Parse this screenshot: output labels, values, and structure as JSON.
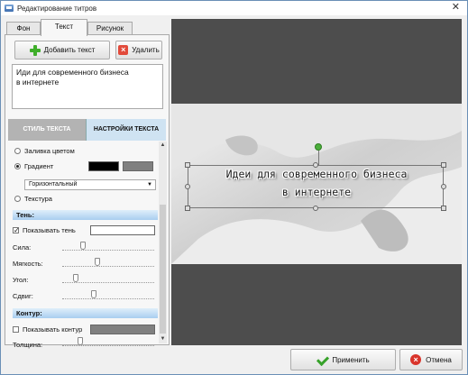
{
  "window": {
    "title": "Редактирование титров",
    "close_glyph": "✕"
  },
  "tabs": [
    "Фон",
    "Текст",
    "Рисунок"
  ],
  "text_tab": {
    "add_button": "Добавить текст",
    "delete_button": "Удалить",
    "text_lines": [
      "Иди для современного бизнеса",
      "в интернете"
    ],
    "subtabs": [
      "СТИЛЬ ТЕКСТА",
      "НАСТРОЙКИ ТЕКСТА"
    ],
    "fill": {
      "solid_label": "Заливка цветом",
      "gradient_label": "Градиент",
      "gradient_color1": "#000000",
      "gradient_color2": "#808080",
      "gradient_direction": "Горизонтальный",
      "texture_label": "Текстура"
    },
    "shadow": {
      "section": "Тень:",
      "show_label": "Показывать тень",
      "show_checked": true,
      "check_glyph": "✓",
      "strength_label": "Сила:",
      "softness_label": "Мягкость:",
      "angle_label": "Угол:",
      "offset_label": "Сдвиг:",
      "strength": 0.21,
      "softness": 0.38,
      "angle": 0.13,
      "offset": 0.33
    },
    "outline": {
      "section": "Контур:",
      "show_label": "Показывать контур",
      "color": "#808080",
      "thickness_label": "Толщина:",
      "thickness": 0.18
    }
  },
  "preview": {
    "caption": [
      "Идеи для современного бизнеса",
      "в интернете"
    ]
  },
  "footer": {
    "apply": "Применить",
    "cancel": "Отмена"
  },
  "colors": {
    "accent": "#a9cdf0",
    "apply_icon": "#37a22a",
    "cancel_icon": "#d9342b",
    "add_icon": "#3fae2a"
  }
}
